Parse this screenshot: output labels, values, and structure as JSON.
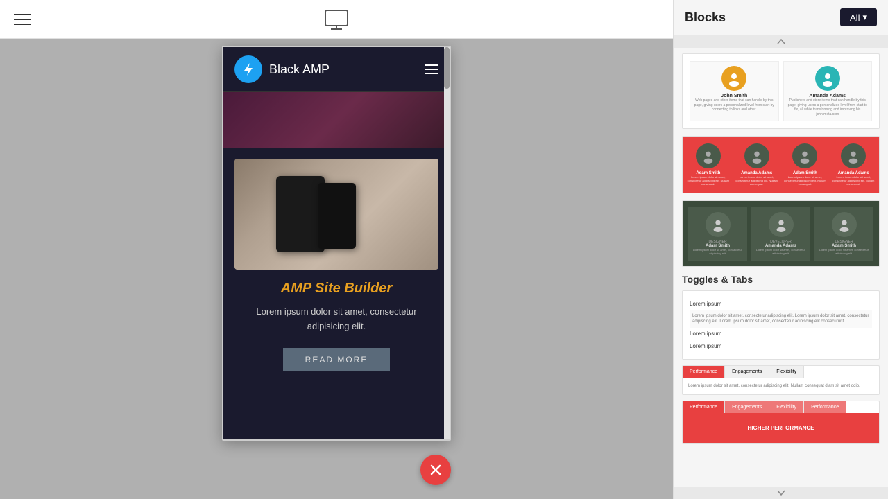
{
  "toolbar": {
    "monitor_icon_label": "monitor",
    "hamburger_label": "menu"
  },
  "preview": {
    "brand_name": "Black AMP",
    "heading": "AMP Site Builder",
    "body_text": "Lorem ipsum dolor sit amet, consectetur adipisicing elit.",
    "read_more": "READ MORE",
    "nav_hamburger": "menu"
  },
  "sidebar": {
    "title": "Blocks",
    "all_button": "All",
    "all_dropdown_arrow": "▾",
    "sections": {
      "team": {
        "label": "",
        "members_2col": [
          {
            "name": "John Smith",
            "desc": "Web pages and other items that can handle by this page, giving users a personalized level from start by connecting to links and other."
          },
          {
            "name": "Amanda Adams",
            "desc": "Publishers and store items that can handle by this page, giving users a personalized level from start to fix, all while transforming and improving his john.meta.com"
          }
        ],
        "members_4col": [
          {
            "name": "Adam Smith",
            "desc": "Lorem ipsum dolor sit amet, consectetur adipiscing elit. Nullam consequat."
          },
          {
            "name": "Amanda Adams",
            "desc": "Lorem ipsum dolor sit amet, consectetur adipiscing elit. Nullam consequat."
          },
          {
            "name": "Adam Smith",
            "desc": "Lorem ipsum dolor sit amet, consectetur adipiscing elit. Nullam consequat."
          },
          {
            "name": "Amanda Adams",
            "desc": "Lorem ipsum dolor sit amet, consectetur adipiscing elit. Nullam consequat."
          }
        ],
        "members_3col": [
          {
            "name": "Adam Smith",
            "role": "DESIGNER",
            "desc": "Lorem ipsum dolor sit amet, consectetur adipiscing elit."
          },
          {
            "name": "Amanda Adams",
            "role": "DEVELOPER",
            "desc": "Lorem ipsum dolor sit amet, consectetur adipiscing elit."
          },
          {
            "name": "Adam Smith",
            "role": "DESIGNER",
            "desc": "Lorem ipsum dolor sit amet, consectetur adipiscing elit."
          }
        ]
      },
      "toggles_tabs": {
        "label": "Toggles & Tabs",
        "toggle_block": {
          "items": [
            {
              "label": "Lorem ipsum",
              "expanded": true,
              "content": "Lorem ipsum dolor sit amet, consectetur adipiscing elit. Lorem ipsum dolor sit amet, consectetur adipiscing elit. Lorem ipsum dolor sit amet, consectetur adipiscing elit consecurunt."
            },
            {
              "label": "Lorem ipsum",
              "expanded": false
            },
            {
              "label": "Lorem ipsum",
              "expanded": false
            }
          ]
        },
        "tabs_block_1": {
          "tabs": [
            "Performance",
            "Engagements",
            "Flexibility"
          ],
          "active_tab": 0,
          "content": "Lorem ipsum dolor sit amet, consectetur adipiscing elit. Nullam consequat diam sit amet odio."
        },
        "tabs_block_2": {
          "tabs": [
            "Performance",
            "Engagements",
            "Flexibility",
            "Performance"
          ],
          "active_tab": 0,
          "content": "HIGHER PERFORMANCE"
        }
      }
    }
  }
}
